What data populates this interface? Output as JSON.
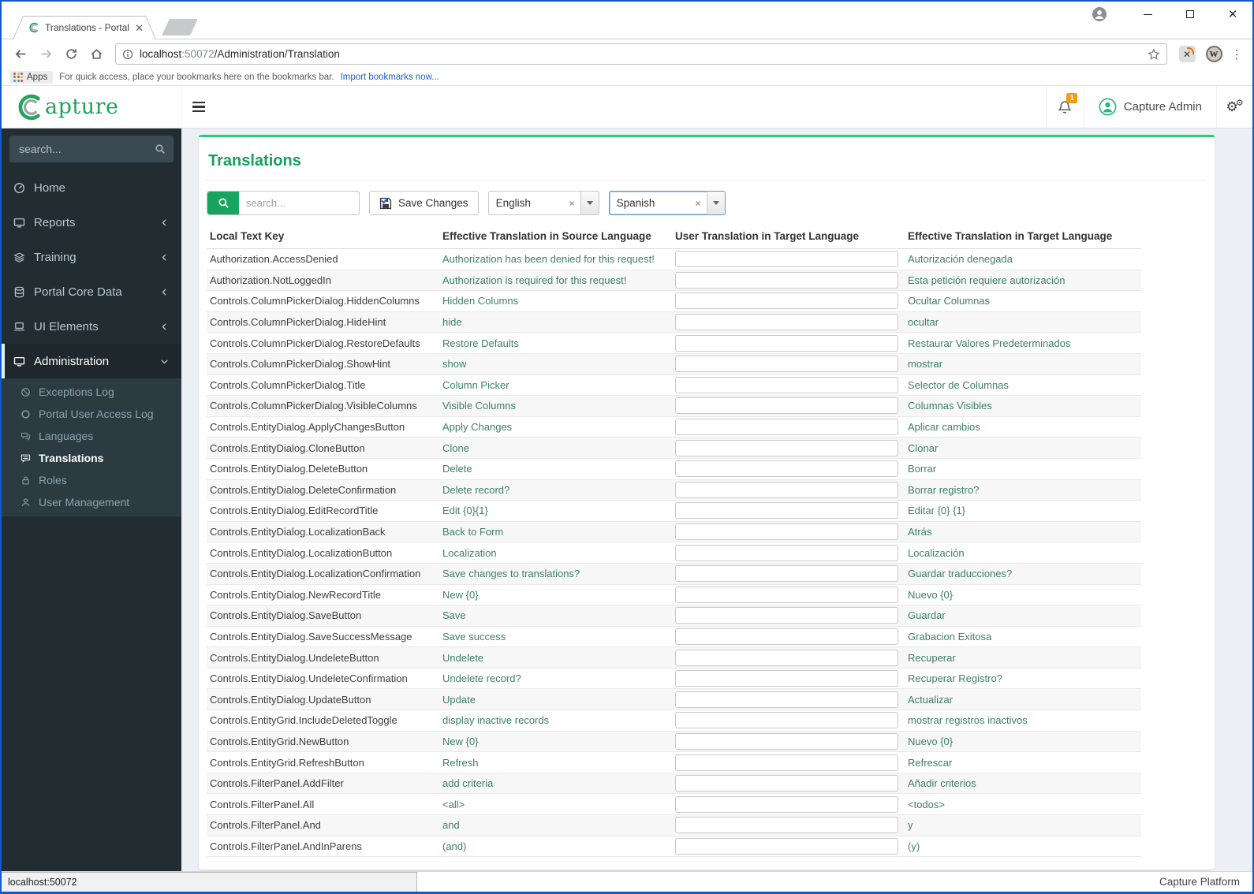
{
  "browser": {
    "tab_title": "Translations - Portal",
    "url_host": "localhost",
    "url_port": ":50072",
    "url_path": "/Administration/Translation",
    "apps_label": "Apps",
    "bookmarks_hint": "For quick access, place your bookmarks here on the bookmarks bar.",
    "bookmarks_link": "Import bookmarks now...",
    "status_text": "localhost:50072"
  },
  "header": {
    "brand": "apture",
    "notification_count": "1",
    "user_name": "Capture Admin"
  },
  "sidebar": {
    "search_placeholder": "search...",
    "items": [
      {
        "label": "Home",
        "icon": "gauge",
        "slug": "home"
      },
      {
        "label": "Reports",
        "icon": "monitor",
        "slug": "reports",
        "chevron": "left"
      },
      {
        "label": "Training",
        "icon": "layers",
        "slug": "training",
        "chevron": "left"
      },
      {
        "label": "Portal Core Data",
        "icon": "database",
        "slug": "portal-core-data",
        "chevron": "left"
      },
      {
        "label": "UI Elements",
        "icon": "laptop",
        "slug": "ui-elements",
        "chevron": "left"
      },
      {
        "label": "Administration",
        "icon": "monitor",
        "slug": "administration",
        "chevron": "down",
        "active": true,
        "children": [
          {
            "label": "Exceptions Log",
            "icon": "ban",
            "slug": "exceptions-log"
          },
          {
            "label": "Portal User Access Log",
            "icon": "circle",
            "slug": "portal-user-access-log"
          },
          {
            "label": "Languages",
            "icon": "comments",
            "slug": "languages"
          },
          {
            "label": "Translations",
            "icon": "commentList",
            "slug": "translations",
            "active": true
          },
          {
            "label": "Roles",
            "icon": "lock",
            "slug": "roles"
          },
          {
            "label": "User Management",
            "icon": "user",
            "slug": "user-management"
          }
        ]
      }
    ]
  },
  "main": {
    "title": "Translations",
    "toolbar": {
      "search_placeholder": "search...",
      "save_label": "Save Changes",
      "source_language": "English",
      "target_language": "Spanish",
      "clear_glyph": "×"
    },
    "table": {
      "columns": [
        "Local Text Key",
        "Effective Translation in Source Language",
        "User Translation in Target Language",
        "Effective Translation in Target Language"
      ],
      "rows": [
        {
          "key": "Authorization.AccessDenied",
          "source": "Authorization has been denied for this request!",
          "user": "",
          "target": "Autorización denegada"
        },
        {
          "key": "Authorization.NotLoggedIn",
          "source": "Authorization is required for this request!",
          "user": "",
          "target": "Esta petición requiere autorización"
        },
        {
          "key": "Controls.ColumnPickerDialog.HiddenColumns",
          "source": "Hidden Columns",
          "user": "",
          "target": "Ocultar Columnas"
        },
        {
          "key": "Controls.ColumnPickerDialog.HideHint",
          "source": "hide",
          "user": "",
          "target": "ocultar"
        },
        {
          "key": "Controls.ColumnPickerDialog.RestoreDefaults",
          "source": "Restore Defaults",
          "user": "",
          "target": "Restaurar Valores Predeterminados"
        },
        {
          "key": "Controls.ColumnPickerDialog.ShowHint",
          "source": "show",
          "user": "",
          "target": "mostrar"
        },
        {
          "key": "Controls.ColumnPickerDialog.Title",
          "source": "Column Picker",
          "user": "",
          "target": "Selector de Columnas"
        },
        {
          "key": "Controls.ColumnPickerDialog.VisibleColumns",
          "source": "Visible Columns",
          "user": "",
          "target": "Columnas Visibles"
        },
        {
          "key": "Controls.EntityDialog.ApplyChangesButton",
          "source": "Apply Changes",
          "user": "",
          "target": "Aplicar cambios"
        },
        {
          "key": "Controls.EntityDialog.CloneButton",
          "source": "Clone",
          "user": "",
          "target": "Clonar"
        },
        {
          "key": "Controls.EntityDialog.DeleteButton",
          "source": "Delete",
          "user": "",
          "target": "Borrar"
        },
        {
          "key": "Controls.EntityDialog.DeleteConfirmation",
          "source": "Delete record?",
          "user": "",
          "target": "Borrar registro?"
        },
        {
          "key": "Controls.EntityDialog.EditRecordTitle",
          "source": "Edit {0}{1}",
          "user": "",
          "target": "Editar {0} {1}"
        },
        {
          "key": "Controls.EntityDialog.LocalizationBack",
          "source": "Back to Form",
          "user": "",
          "target": "Atrás"
        },
        {
          "key": "Controls.EntityDialog.LocalizationButton",
          "source": "Localization",
          "user": "",
          "target": "Localización"
        },
        {
          "key": "Controls.EntityDialog.LocalizationConfirmation",
          "source": "Save changes to translations?",
          "user": "",
          "target": "Guardar traducciones?"
        },
        {
          "key": "Controls.EntityDialog.NewRecordTitle",
          "source": "New {0}",
          "user": "",
          "target": "Nuevo {0}"
        },
        {
          "key": "Controls.EntityDialog.SaveButton",
          "source": "Save",
          "user": "",
          "target": "Guardar"
        },
        {
          "key": "Controls.EntityDialog.SaveSuccessMessage",
          "source": "Save success",
          "user": "",
          "target": "Grabacion Exitosa"
        },
        {
          "key": "Controls.EntityDialog.UndeleteButton",
          "source": "Undelete",
          "user": "",
          "target": "Recuperar"
        },
        {
          "key": "Controls.EntityDialog.UndeleteConfirmation",
          "source": "Undelete record?",
          "user": "",
          "target": "Recuperar Registro?"
        },
        {
          "key": "Controls.EntityDialog.UpdateButton",
          "source": "Update",
          "user": "",
          "target": "Actualizar"
        },
        {
          "key": "Controls.EntityGrid.IncludeDeletedToggle",
          "source": "display inactive records",
          "user": "",
          "target": "mostrar registros inactivos"
        },
        {
          "key": "Controls.EntityGrid.NewButton",
          "source": "New {0}",
          "user": "",
          "target": "Nuevo {0}"
        },
        {
          "key": "Controls.EntityGrid.RefreshButton",
          "source": "Refresh",
          "user": "",
          "target": "Refrescar"
        },
        {
          "key": "Controls.FilterPanel.AddFilter",
          "source": "add criteria",
          "user": "",
          "target": "Añadir criterios"
        },
        {
          "key": "Controls.FilterPanel.All",
          "source": "<all>",
          "user": "",
          "target": "<todos>"
        },
        {
          "key": "Controls.FilterPanel.And",
          "source": "and",
          "user": "",
          "target": "y"
        },
        {
          "key": "Controls.FilterPanel.AndInParens",
          "source": "(and)",
          "user": "",
          "target": "(y)"
        }
      ]
    },
    "footer": "Capture Platform"
  },
  "colors": {
    "accent_green": "#17a45f",
    "card_top_green": "#2ecc71",
    "sidebar_bg": "#222d32",
    "submenu_bg": "#2c3b41",
    "badge_orange": "#f39c12",
    "link_blue": "#1a62d8",
    "focus_blue": "#5b9dd9",
    "window_border_blue": "#1259cb",
    "translation_text": "#3e7e6b"
  }
}
